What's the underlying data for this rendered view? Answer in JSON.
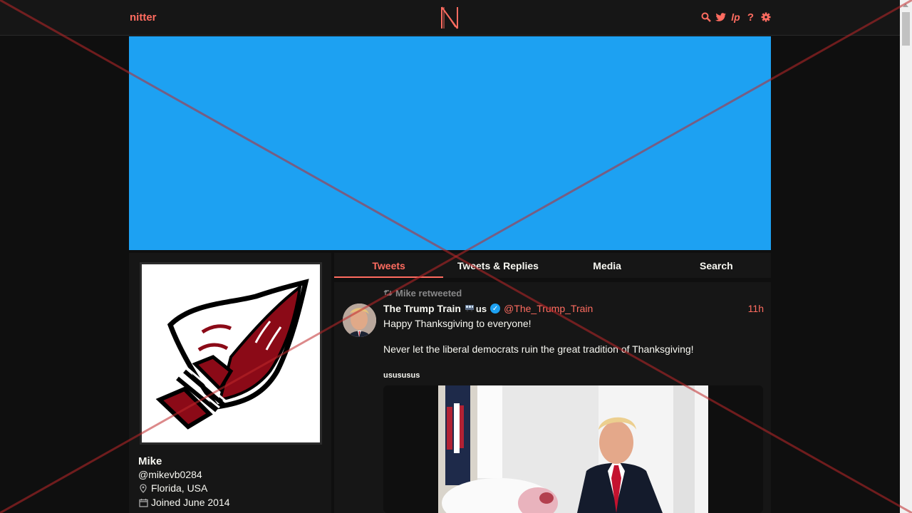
{
  "nav": {
    "brand": "nitter",
    "logo_letter": "N",
    "icons": [
      "search-icon",
      "twitter-bird-icon",
      "lp-icon",
      "help-icon",
      "settings-icon"
    ],
    "lp_label": "lp",
    "help_label": "?"
  },
  "colors": {
    "accent": "#ff6c60",
    "banner": "#1da1f2",
    "background": "#0f0f0f",
    "panel": "#161616",
    "overlay_line": "#c0282a"
  },
  "profile": {
    "name": "Mike",
    "handle": "@mikevb0284",
    "location": "Florida, USA",
    "joined": "Joined June 2014"
  },
  "tabs": [
    {
      "label": "Tweets",
      "active": true
    },
    {
      "label": "Tweets & Replies",
      "active": false
    },
    {
      "label": "Media",
      "active": false
    },
    {
      "label": "Search",
      "active": false
    }
  ],
  "tweet": {
    "retweet_label": "Mike retweeted",
    "fullname": "The Trump Train",
    "badge_text": "us",
    "username": "@The_Trump_Train",
    "date": "11h",
    "text_lines": [
      "Happy Thanksgiving to everyone!",
      "Never let the liberal democrats ruin the great tradition of Thanksgiving!"
    ],
    "card_title": "usususus"
  }
}
